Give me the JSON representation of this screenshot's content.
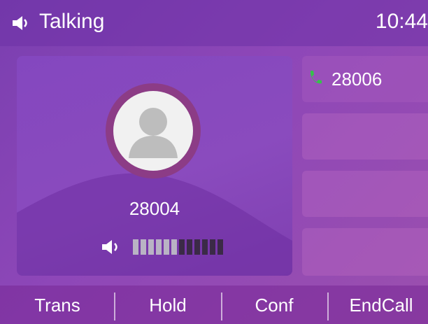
{
  "status_bar": {
    "state_label": "Talking",
    "time": "10:44",
    "state_icon": "speaker-icon"
  },
  "call": {
    "remote_number": "28004",
    "avatar_icon": "contact-avatar-icon"
  },
  "volume": {
    "icon": "speaker-icon",
    "level": 6,
    "total_steps": 12,
    "active_color": "#b9b3c4",
    "inactive_color": "#3b2a47"
  },
  "line_keys": [
    {
      "label": "28006",
      "icon": "phone-icon",
      "icon_color": "#35c24a"
    },
    {
      "label": ""
    },
    {
      "label": ""
    },
    {
      "label": ""
    }
  ],
  "softkeys": [
    "Trans",
    "Hold",
    "Conf",
    "EndCall"
  ]
}
